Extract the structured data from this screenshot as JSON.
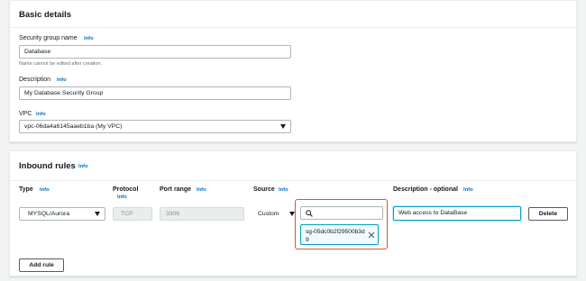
{
  "basic_details": {
    "title": "Basic details",
    "sg_name_label": "Security group name",
    "sg_name_info": "Info",
    "sg_name_value": "Database",
    "sg_name_hint": "Name cannot be edited after creation.",
    "description_label": "Description",
    "description_info": "Info",
    "description_value": "My Database Security Group",
    "vpc_label": "VPC",
    "vpc_info": "Info",
    "vpc_value": "vpc-06da4a6145aaeb1ba (My VPC)"
  },
  "inbound_rules": {
    "title": "Inbound rules",
    "title_info": "Info",
    "columns": {
      "type": "Type",
      "type_info": "Info",
      "protocol": "Protocol",
      "protocol_info": "Info",
      "port_range": "Port range",
      "port_range_info": "Info",
      "source": "Source",
      "source_info": "Info",
      "description": "Description - optional",
      "description_info": "Info"
    },
    "rule": {
      "type": "MYSQL/Aurora",
      "protocol": "TCP",
      "port_range": "3306",
      "source_type": "Custom",
      "source_search_placeholder": "",
      "source_token": "sg-05dc0b2f29500b3d9",
      "description": "Web access to DataBase",
      "delete_label": "Delete"
    },
    "add_rule_label": "Add rule"
  },
  "icons": {
    "search": "search-icon",
    "dismiss": "close-icon",
    "dropdown": "caret-down-icon"
  },
  "colors": {
    "info_link": "#0073bb",
    "focus": "#00a1c9",
    "highlight": "#e2542d",
    "background": "#f2f3f3"
  }
}
